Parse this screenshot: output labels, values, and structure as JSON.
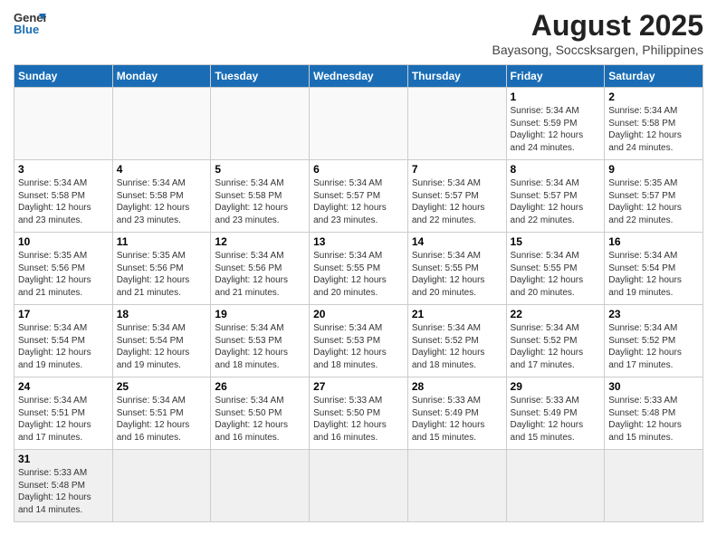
{
  "logo": {
    "text_general": "General",
    "text_blue": "Blue"
  },
  "header": {
    "month": "August 2025",
    "location": "Bayasong, Soccsksargen, Philippines"
  },
  "weekdays": [
    "Sunday",
    "Monday",
    "Tuesday",
    "Wednesday",
    "Thursday",
    "Friday",
    "Saturday"
  ],
  "weeks": [
    [
      {
        "day": "",
        "info": ""
      },
      {
        "day": "",
        "info": ""
      },
      {
        "day": "",
        "info": ""
      },
      {
        "day": "",
        "info": ""
      },
      {
        "day": "",
        "info": ""
      },
      {
        "day": "1",
        "info": "Sunrise: 5:34 AM\nSunset: 5:59 PM\nDaylight: 12 hours\nand 24 minutes."
      },
      {
        "day": "2",
        "info": "Sunrise: 5:34 AM\nSunset: 5:58 PM\nDaylight: 12 hours\nand 24 minutes."
      }
    ],
    [
      {
        "day": "3",
        "info": "Sunrise: 5:34 AM\nSunset: 5:58 PM\nDaylight: 12 hours\nand 23 minutes."
      },
      {
        "day": "4",
        "info": "Sunrise: 5:34 AM\nSunset: 5:58 PM\nDaylight: 12 hours\nand 23 minutes."
      },
      {
        "day": "5",
        "info": "Sunrise: 5:34 AM\nSunset: 5:58 PM\nDaylight: 12 hours\nand 23 minutes."
      },
      {
        "day": "6",
        "info": "Sunrise: 5:34 AM\nSunset: 5:57 PM\nDaylight: 12 hours\nand 23 minutes."
      },
      {
        "day": "7",
        "info": "Sunrise: 5:34 AM\nSunset: 5:57 PM\nDaylight: 12 hours\nand 22 minutes."
      },
      {
        "day": "8",
        "info": "Sunrise: 5:34 AM\nSunset: 5:57 PM\nDaylight: 12 hours\nand 22 minutes."
      },
      {
        "day": "9",
        "info": "Sunrise: 5:35 AM\nSunset: 5:57 PM\nDaylight: 12 hours\nand 22 minutes."
      }
    ],
    [
      {
        "day": "10",
        "info": "Sunrise: 5:35 AM\nSunset: 5:56 PM\nDaylight: 12 hours\nand 21 minutes."
      },
      {
        "day": "11",
        "info": "Sunrise: 5:35 AM\nSunset: 5:56 PM\nDaylight: 12 hours\nand 21 minutes."
      },
      {
        "day": "12",
        "info": "Sunrise: 5:34 AM\nSunset: 5:56 PM\nDaylight: 12 hours\nand 21 minutes."
      },
      {
        "day": "13",
        "info": "Sunrise: 5:34 AM\nSunset: 5:55 PM\nDaylight: 12 hours\nand 20 minutes."
      },
      {
        "day": "14",
        "info": "Sunrise: 5:34 AM\nSunset: 5:55 PM\nDaylight: 12 hours\nand 20 minutes."
      },
      {
        "day": "15",
        "info": "Sunrise: 5:34 AM\nSunset: 5:55 PM\nDaylight: 12 hours\nand 20 minutes."
      },
      {
        "day": "16",
        "info": "Sunrise: 5:34 AM\nSunset: 5:54 PM\nDaylight: 12 hours\nand 19 minutes."
      }
    ],
    [
      {
        "day": "17",
        "info": "Sunrise: 5:34 AM\nSunset: 5:54 PM\nDaylight: 12 hours\nand 19 minutes."
      },
      {
        "day": "18",
        "info": "Sunrise: 5:34 AM\nSunset: 5:54 PM\nDaylight: 12 hours\nand 19 minutes."
      },
      {
        "day": "19",
        "info": "Sunrise: 5:34 AM\nSunset: 5:53 PM\nDaylight: 12 hours\nand 18 minutes."
      },
      {
        "day": "20",
        "info": "Sunrise: 5:34 AM\nSunset: 5:53 PM\nDaylight: 12 hours\nand 18 minutes."
      },
      {
        "day": "21",
        "info": "Sunrise: 5:34 AM\nSunset: 5:52 PM\nDaylight: 12 hours\nand 18 minutes."
      },
      {
        "day": "22",
        "info": "Sunrise: 5:34 AM\nSunset: 5:52 PM\nDaylight: 12 hours\nand 17 minutes."
      },
      {
        "day": "23",
        "info": "Sunrise: 5:34 AM\nSunset: 5:52 PM\nDaylight: 12 hours\nand 17 minutes."
      }
    ],
    [
      {
        "day": "24",
        "info": "Sunrise: 5:34 AM\nSunset: 5:51 PM\nDaylight: 12 hours\nand 17 minutes."
      },
      {
        "day": "25",
        "info": "Sunrise: 5:34 AM\nSunset: 5:51 PM\nDaylight: 12 hours\nand 16 minutes."
      },
      {
        "day": "26",
        "info": "Sunrise: 5:34 AM\nSunset: 5:50 PM\nDaylight: 12 hours\nand 16 minutes."
      },
      {
        "day": "27",
        "info": "Sunrise: 5:33 AM\nSunset: 5:50 PM\nDaylight: 12 hours\nand 16 minutes."
      },
      {
        "day": "28",
        "info": "Sunrise: 5:33 AM\nSunset: 5:49 PM\nDaylight: 12 hours\nand 15 minutes."
      },
      {
        "day": "29",
        "info": "Sunrise: 5:33 AM\nSunset: 5:49 PM\nDaylight: 12 hours\nand 15 minutes."
      },
      {
        "day": "30",
        "info": "Sunrise: 5:33 AM\nSunset: 5:48 PM\nDaylight: 12 hours\nand 15 minutes."
      }
    ],
    [
      {
        "day": "31",
        "info": "Sunrise: 5:33 AM\nSunset: 5:48 PM\nDaylight: 12 hours\nand 14 minutes."
      },
      {
        "day": "",
        "info": ""
      },
      {
        "day": "",
        "info": ""
      },
      {
        "day": "",
        "info": ""
      },
      {
        "day": "",
        "info": ""
      },
      {
        "day": "",
        "info": ""
      },
      {
        "day": "",
        "info": ""
      }
    ]
  ]
}
